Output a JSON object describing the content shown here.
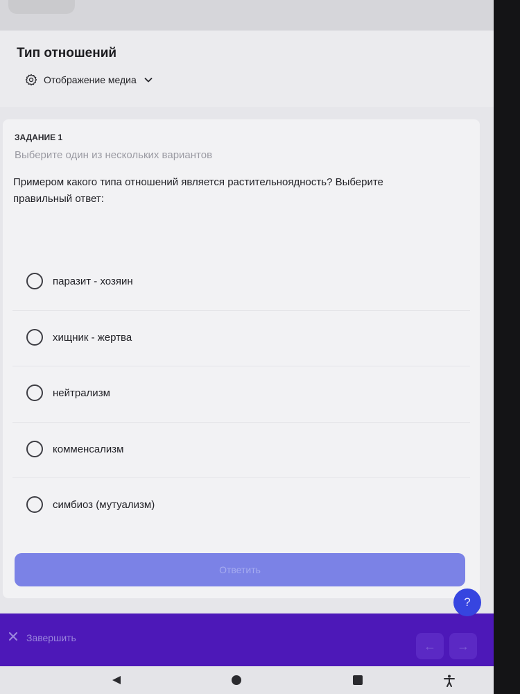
{
  "header": {
    "title": "Тип отношений",
    "media_toggle_label": "Отображение медиа"
  },
  "task": {
    "number_label": "ЗАДАНИЕ 1",
    "hint": "Выберите один из нескольких вариантов",
    "question": "Примером какого типа отношений является растительноядность? Выберите правильный ответ:",
    "options": [
      {
        "label": "паразит - хозяин"
      },
      {
        "label": "хищник - жертва"
      },
      {
        "label": "нейтрализм"
      },
      {
        "label": "комменсализм"
      },
      {
        "label": "симбиоз (мутуализм)"
      }
    ],
    "submit_label": "Ответить"
  },
  "help": {
    "label": "?"
  },
  "footer": {
    "finish_label": "Завершить",
    "prev_glyph": "←",
    "next_glyph": "→"
  },
  "icons": {
    "media_settings": "gear-icon",
    "media_dropdown": "chevron-down-icon",
    "finish": "close-icon",
    "system_back": "triangle-back-icon",
    "system_home": "circle-home-icon",
    "system_recents": "square-recents-icon",
    "system_accessibility": "accessibility-icon"
  },
  "colors": {
    "accent": "#4d18b8",
    "submit_button": "#7b82e6",
    "help_button": "#3645e0"
  }
}
